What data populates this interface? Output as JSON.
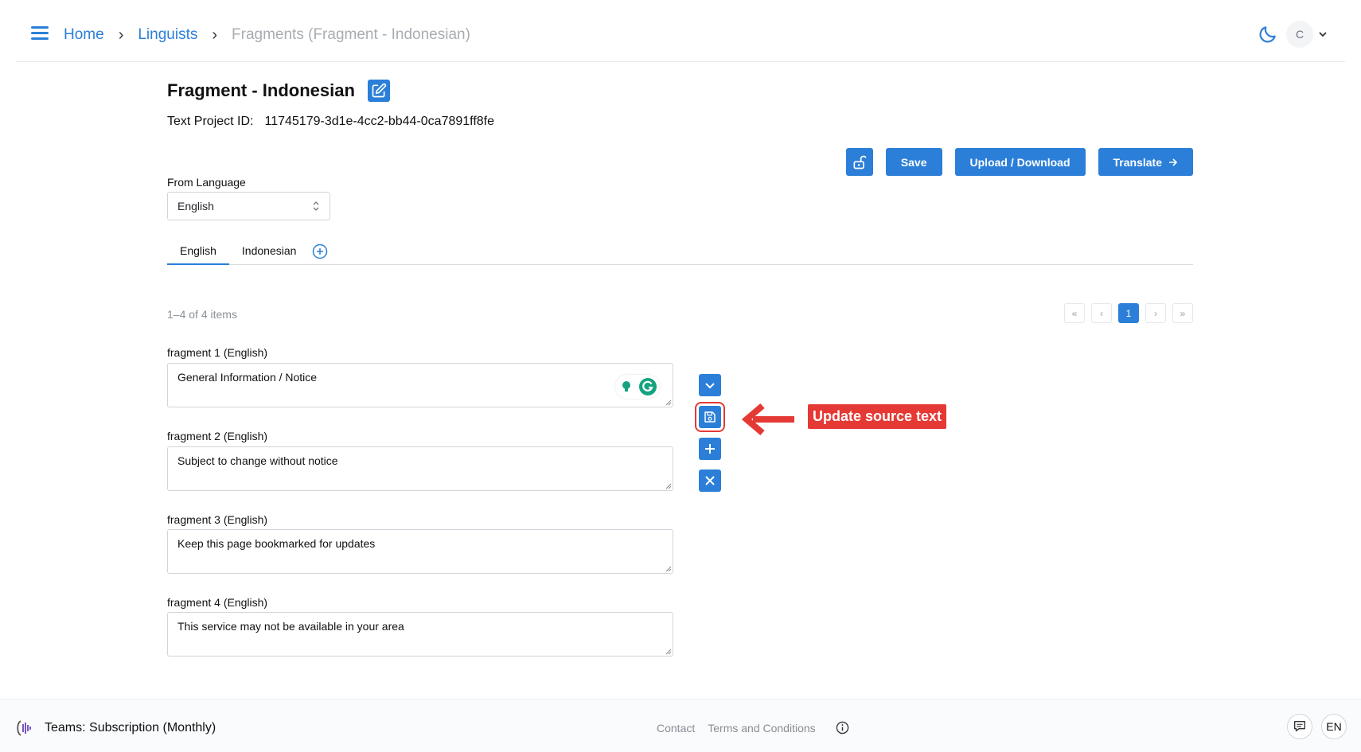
{
  "header": {
    "breadcrumb": {
      "home": "Home",
      "linguists": "Linguists",
      "current": "Fragments (Fragment - Indonesian)"
    },
    "avatar_initial": "C"
  },
  "main": {
    "title": "Fragment - Indonesian",
    "project_id_label": "Text Project ID:",
    "project_id_value": "11745179-3d1e-4cc2-bb44-0ca7891ff8fe",
    "actions": {
      "save": "Save",
      "upload_download": "Upload / Download",
      "translate": "Translate"
    },
    "from_language_label": "From Language",
    "from_language_value": "English",
    "tabs": [
      "English",
      "Indonesian"
    ],
    "items_count": "1–4 of 4 items",
    "pager": {
      "current_page": "1"
    },
    "fragments": [
      {
        "label": "fragment 1 (English)",
        "value": "General Information / Notice"
      },
      {
        "label": "fragment 2 (English)",
        "value": "Subject to change without notice"
      },
      {
        "label": "fragment 3 (English)",
        "value": "Keep this page bookmarked for updates"
      },
      {
        "label": "fragment 4 (English)",
        "value": "This service may not be available in your area"
      }
    ],
    "annotation": "Update source text"
  },
  "footer": {
    "team": "Teams: Subscription (Monthly)",
    "links": [
      "Contact",
      "Terms and Conditions"
    ],
    "language": "EN"
  },
  "colors": {
    "accent": "#2b7fd8",
    "annotation": "#e53935"
  }
}
